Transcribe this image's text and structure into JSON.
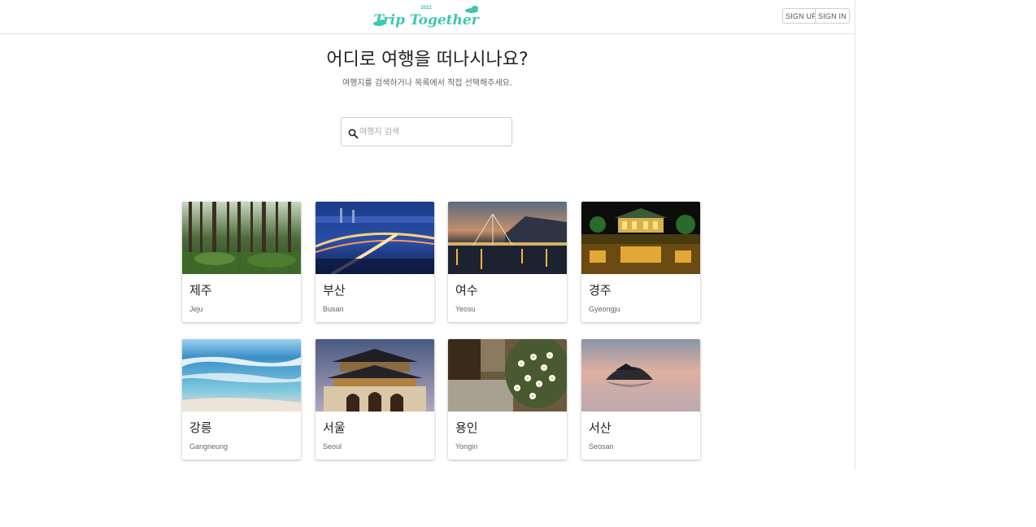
{
  "header": {
    "logo": {
      "year": "2022",
      "text": "Trip Together",
      "color": "#3ec7b0"
    },
    "sign_up_label": "SIGN UP",
    "sign_in_label": "SIGN IN"
  },
  "main": {
    "title": "어디로 여행을 떠나시나요?",
    "subtitle": "여행지를 검색하거나 목록에서 직접 선택해주세요.",
    "search": {
      "placeholder": "여행지 검색",
      "value": ""
    }
  },
  "destinations": [
    {
      "name_ko": "제주",
      "name_en": "Jeju",
      "photo": "forest"
    },
    {
      "name_ko": "부산",
      "name_en": "Busan",
      "photo": "bridge-night"
    },
    {
      "name_ko": "여수",
      "name_en": "Yeosu",
      "photo": "harbor-bridge"
    },
    {
      "name_ko": "경주",
      "name_en": "Gyeongju",
      "photo": "palace-night"
    },
    {
      "name_ko": "강릉",
      "name_en": "Gangneung",
      "photo": "sea-waves"
    },
    {
      "name_ko": "서울",
      "name_en": "Seoul",
      "photo": "palace-gate"
    },
    {
      "name_ko": "용인",
      "name_en": "Yongin",
      "photo": "flowers"
    },
    {
      "name_ko": "서산",
      "name_en": "Seosan",
      "photo": "island-sunset"
    }
  ]
}
